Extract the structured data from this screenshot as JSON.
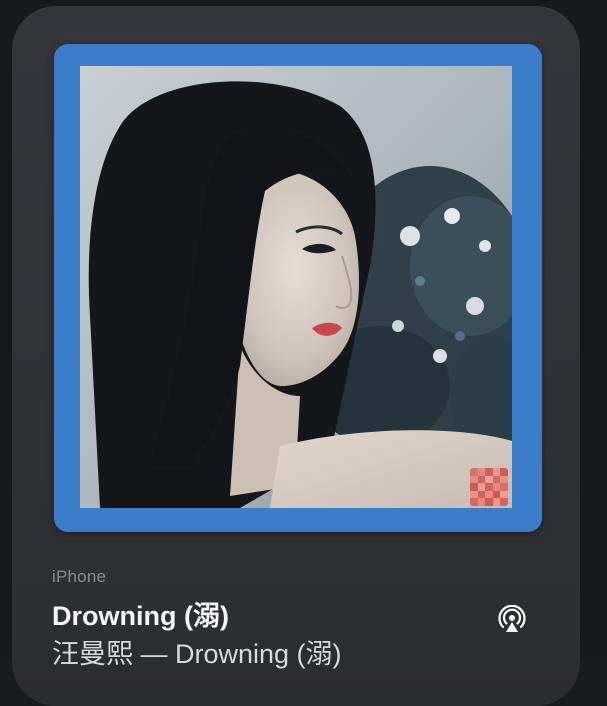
{
  "now_playing": {
    "source": "iPhone",
    "title": "Drowning (溺)",
    "subtitle": "汪曼熙 — Drowning (溺)"
  },
  "artwork": {
    "frame_color": "#3b7dc9",
    "subject": "album-cover-photo"
  },
  "controls": {
    "airplay_icon": "airplay-audio-icon"
  },
  "colors": {
    "background": "#303236",
    "title_text": "#f4f4f6",
    "subtitle_text": "#d9d9dc",
    "source_text": "#8a8b8f"
  }
}
